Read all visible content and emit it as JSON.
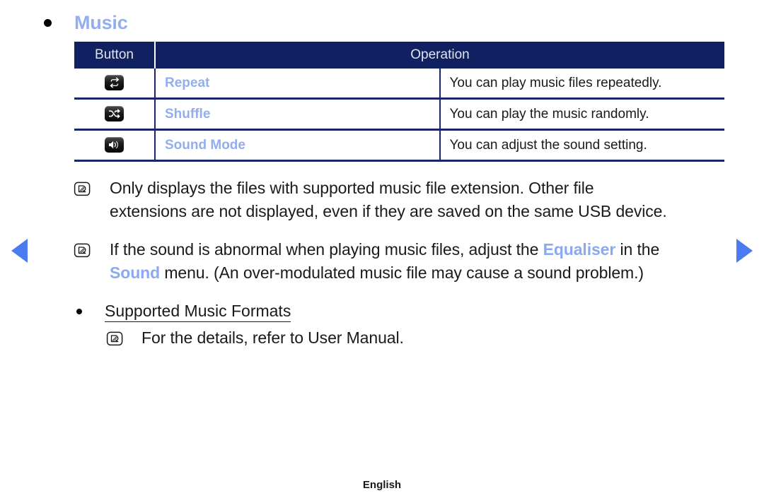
{
  "nav": {
    "prev_icon": "triangle-left-icon",
    "next_icon": "triangle-right-icon",
    "accent_color": "#4a7bf0"
  },
  "heading": {
    "bullet": "●",
    "title": "Music",
    "color": "#92aeee"
  },
  "table": {
    "header": {
      "button": "Button",
      "operation": "Operation",
      "bg_color": "#102060",
      "text_color": "#dfe4ef"
    },
    "rows": [
      {
        "icon": "repeat-icon",
        "label": "Repeat",
        "operation": "You can play music files repeatedly."
      },
      {
        "icon": "shuffle-icon",
        "label": "Shuffle",
        "operation": "You can play the music randomly."
      },
      {
        "icon": "sound-mode-icon",
        "label": "Sound Mode",
        "operation": "You can adjust the sound setting."
      }
    ],
    "label_color": "#92aeee",
    "border_color": "#19266e"
  },
  "notes": [
    {
      "icon": "note-icon",
      "line1": "Only displays the files with supported music file extension. Other file",
      "line2": "extensions are not displayed, even if they are saved on the same USB device."
    }
  ],
  "note_equaliser": {
    "icon": "note-icon",
    "part1": "If the sound is abnormal when playing music files, adjust the ",
    "highlight1": "Equaliser",
    "part2": " in the",
    "highlight2": "Sound",
    "part3": " menu. (An over-modulated music file may cause a sound problem.)",
    "highlight_color": "#8aa9ee"
  },
  "supported_formats": {
    "bullet": "●",
    "label": "Supported Music Formats"
  },
  "note_manual": {
    "icon": "note-icon",
    "text": "For the details, refer to User Manual."
  },
  "footer": {
    "language": "English"
  }
}
